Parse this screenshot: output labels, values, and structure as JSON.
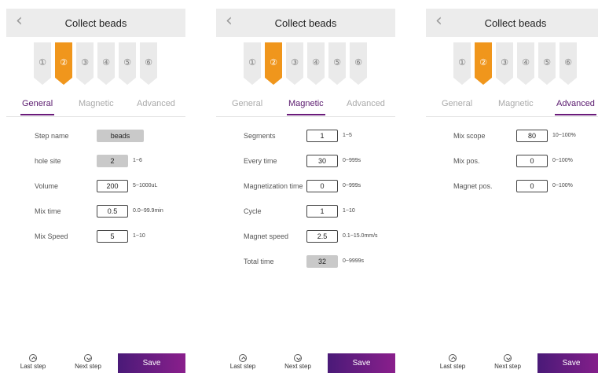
{
  "panels": [
    {
      "header": {
        "title": "Collect beads"
      },
      "steps": [
        "①",
        "②",
        "③",
        "④",
        "⑤",
        "⑥"
      ],
      "active_step": 1,
      "tabs": [
        "General",
        "Magnetic",
        "Advanced"
      ],
      "active_tab": 0,
      "fields": [
        {
          "label": "Step name",
          "value": "beads",
          "range": "",
          "readonly": true,
          "wide": true
        },
        {
          "label": "hole site",
          "value": "2",
          "range": "1~6",
          "readonly": true,
          "wide": false
        },
        {
          "label": "Volume",
          "value": "200",
          "range": "5~1000uL",
          "readonly": false,
          "wide": false
        },
        {
          "label": "Mix time",
          "value": "0.5",
          "range": "0.0~99.9min",
          "readonly": false,
          "wide": false
        },
        {
          "label": "Mix Speed",
          "value": "5",
          "range": "1~10",
          "readonly": false,
          "wide": false
        }
      ],
      "footer": {
        "last": "Last step",
        "next": "Next step",
        "save": "Save"
      }
    },
    {
      "header": {
        "title": "Collect beads"
      },
      "steps": [
        "①",
        "②",
        "③",
        "④",
        "⑤",
        "⑥"
      ],
      "active_step": 1,
      "tabs": [
        "General",
        "Magnetic",
        "Advanced"
      ],
      "active_tab": 1,
      "fields": [
        {
          "label": "Segments",
          "value": "1",
          "range": "1~5",
          "readonly": false,
          "wide": false
        },
        {
          "label": "Every time",
          "value": "30",
          "range": "0~999s",
          "readonly": false,
          "wide": false
        },
        {
          "label": "Magnetization time",
          "value": "0",
          "range": "0~999s",
          "readonly": false,
          "wide": false
        },
        {
          "label": "Cycle",
          "value": "1",
          "range": "1~10",
          "readonly": false,
          "wide": false
        },
        {
          "label": "Magnet speed",
          "value": "2.5",
          "range": "0.1~15.0mm/s",
          "readonly": false,
          "wide": false
        },
        {
          "label": "Total time",
          "value": "32",
          "range": "0~9999s",
          "readonly": true,
          "wide": false
        }
      ],
      "footer": {
        "last": "Last step",
        "next": "Next step",
        "save": "Save"
      }
    },
    {
      "header": {
        "title": "Collect beads"
      },
      "steps": [
        "①",
        "②",
        "③",
        "④",
        "⑤",
        "⑥"
      ],
      "active_step": 1,
      "tabs": [
        "General",
        "Magnetic",
        "Advanced"
      ],
      "active_tab": 2,
      "fields": [
        {
          "label": "Mix scope",
          "value": "80",
          "range": "10~100%",
          "readonly": false,
          "wide": false
        },
        {
          "label": "Mix pos.",
          "value": "0",
          "range": "0~100%",
          "readonly": false,
          "wide": false
        },
        {
          "label": "Magnet pos.",
          "value": "0",
          "range": "0~100%",
          "readonly": false,
          "wide": false
        }
      ],
      "footer": {
        "last": "Last step",
        "next": "Next step",
        "save": "Save"
      }
    }
  ],
  "colors": {
    "accent": "#f0961c",
    "tab_active": "#5a1a6e",
    "save_start": "#4a1a78",
    "save_end": "#8a1f8c"
  }
}
